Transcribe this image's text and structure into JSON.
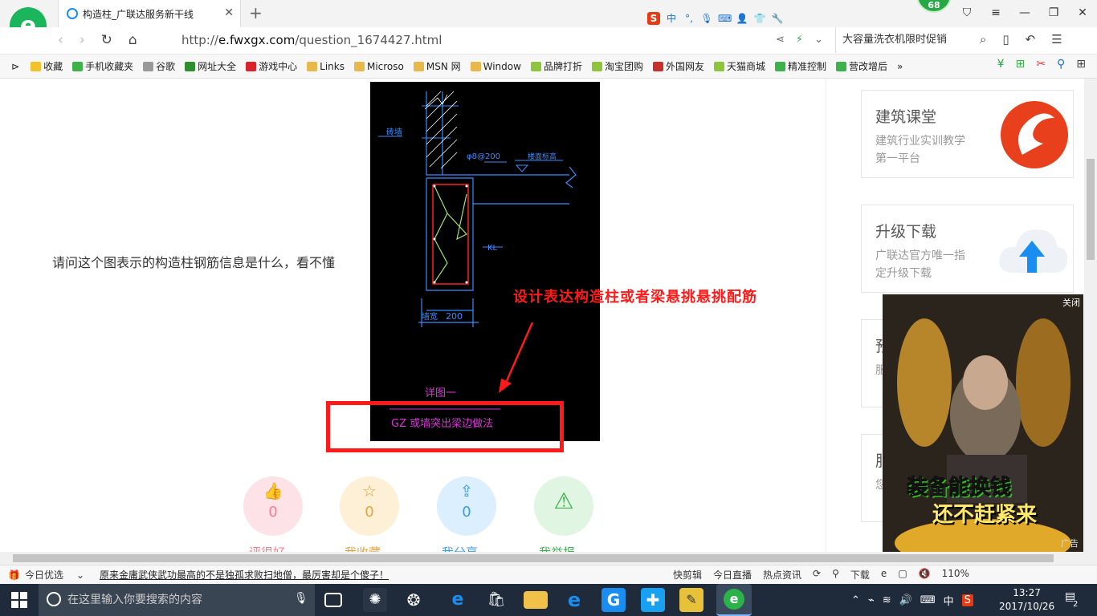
{
  "browser": {
    "tab_title": "构造柱_广联达服务新干线",
    "url_scheme": "http://",
    "url_domain": "e.fwxgx.com",
    "url_path": "/question_1674427.html",
    "promo": "大容量洗衣机限时促销",
    "badge_count": "68",
    "ime_zh": "中"
  },
  "bookmarks": [
    {
      "label": "收藏",
      "color": "#f3c12a"
    },
    {
      "label": "手机收藏夹",
      "color": "#3bb34a"
    },
    {
      "label": "谷歌",
      "color": "#999999"
    },
    {
      "label": "网址大全",
      "color": "#2f8f2f"
    },
    {
      "label": "游戏中心",
      "color": "#d8232a"
    },
    {
      "label": "Links",
      "color": "#e8b84a"
    },
    {
      "label": "Microso",
      "color": "#e8b84a"
    },
    {
      "label": "MSN 网",
      "color": "#e8b84a"
    },
    {
      "label": "Window",
      "color": "#e8b84a"
    },
    {
      "label": "品牌打折",
      "color": "#8fc53a"
    },
    {
      "label": "淘宝团购",
      "color": "#8fc53a"
    },
    {
      "label": "外国网友",
      "color": "#c9302c"
    },
    {
      "label": "天猫商城",
      "color": "#8fc53a"
    },
    {
      "label": "精准控制",
      "color": "#3bb34a"
    },
    {
      "label": "营改增后",
      "color": "#3bb34a"
    }
  ],
  "page": {
    "question": "请问这个图表示的构造柱钢筋信息是什么，看不懂",
    "annotation": "设计表达构造柱或者梁悬挑悬挑配筋",
    "cad": {
      "wall_label": "砖墙",
      "rebar_label": "φ8@200",
      "floor_label": "楼面标高",
      "beam_label": "KL",
      "width_label": "墙宽",
      "dim_label": "200",
      "detail_title": "详图一",
      "detail_caption": "GZ 或墙突出梁边做法"
    },
    "actions": [
      {
        "label": "评很好",
        "count": "0",
        "color": "#ff7a8a",
        "bg": "#fde3e7"
      },
      {
        "label": "我收藏",
        "count": "0",
        "color": "#e8a23a",
        "bg": "#fdf0d6"
      },
      {
        "label": "我分享",
        "count": "0",
        "color": "#3a9be8",
        "bg": "#dcefff"
      },
      {
        "label": "我举报",
        "count": "",
        "color": "#3bb34a",
        "bg": "#e0f5e2"
      }
    ]
  },
  "sidebar": [
    {
      "title": "建筑课堂",
      "desc": "建筑行业实训教学第一平台"
    },
    {
      "title": "升级下载",
      "desc": "广联达官方唯一指定升级下载"
    },
    {
      "title": "预",
      "desc": "服诺"
    },
    {
      "title": "服",
      "desc": "您家"
    }
  ],
  "ad": {
    "close": "关闭",
    "line1": "装备能换钱",
    "line2": "还不赶紧来",
    "label": "广告"
  },
  "statusbar": {
    "today": "今日优选",
    "news": "原来金庸武侠武功最高的不是独孤求败扫地僧，最厉害却是个傻子！",
    "items": [
      "快剪辑",
      "今日直播",
      "热点资讯"
    ],
    "download": "下载",
    "zoom": "110%"
  },
  "taskbar": {
    "search_placeholder": "在这里输入你要搜索的内容",
    "ime": "中",
    "time": "13:27",
    "date": "2017/10/26",
    "notif": "2"
  }
}
